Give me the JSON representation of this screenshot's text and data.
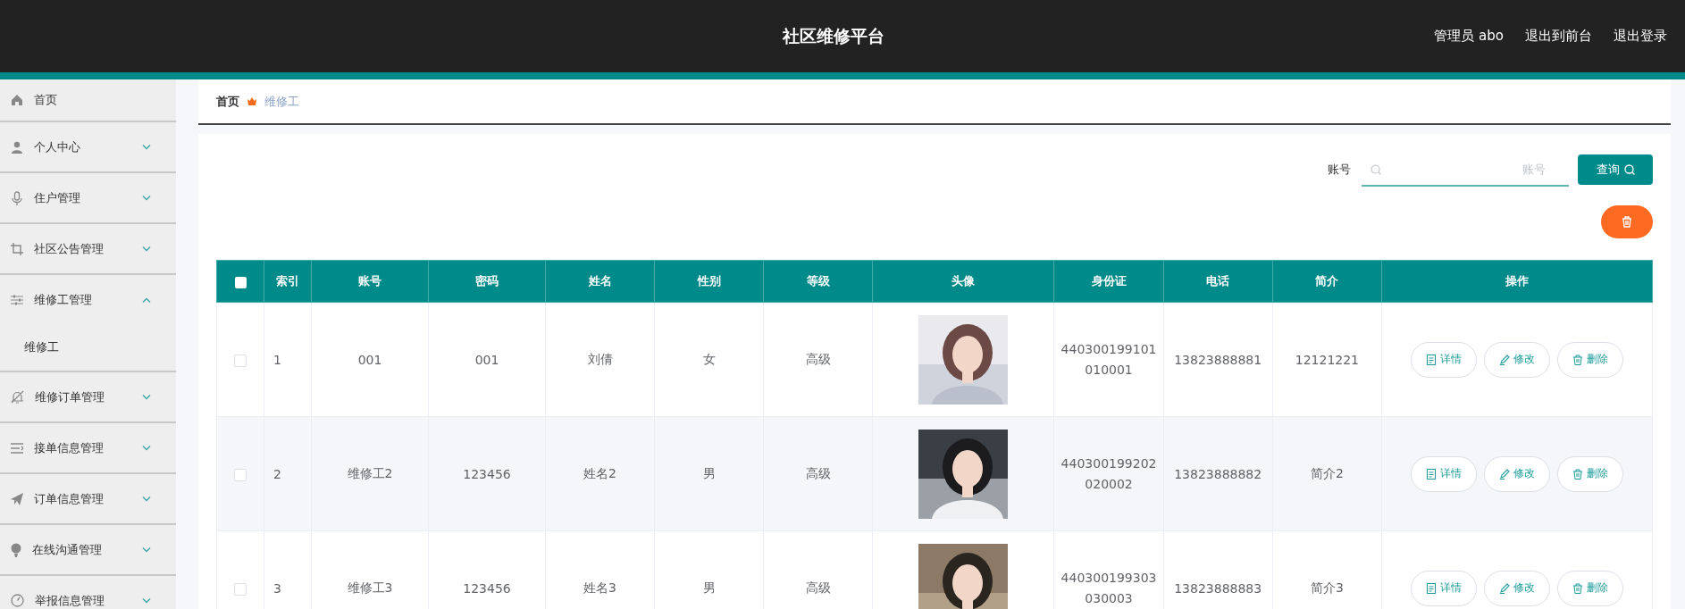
{
  "header": {
    "title": "社区维修平台",
    "user": "管理员 abo",
    "links": [
      "退出到前台",
      "退出登录"
    ]
  },
  "sidebar": {
    "items": [
      {
        "kind": "link",
        "label": "首页"
      },
      {
        "kind": "menu",
        "label": "个人中心",
        "expanded": false
      },
      {
        "kind": "menu",
        "label": "住户管理",
        "expanded": false
      },
      {
        "kind": "menu",
        "label": "社区公告管理",
        "expanded": false
      },
      {
        "kind": "menu",
        "label": "维修工管理",
        "expanded": true,
        "children": [
          {
            "label": "维修工"
          }
        ]
      },
      {
        "kind": "menu",
        "label": "维修订单管理",
        "expanded": false
      },
      {
        "kind": "menu",
        "label": "接单信息管理",
        "expanded": false
      },
      {
        "kind": "menu",
        "label": "订单信息管理",
        "expanded": false
      },
      {
        "kind": "menu",
        "label": "在线沟通管理",
        "expanded": false
      },
      {
        "kind": "menu",
        "label": "举报信息管理",
        "expanded": false
      }
    ]
  },
  "breadcrumb": [
    {
      "label": "首页",
      "current": false
    },
    {
      "label": "维修工",
      "current": true
    }
  ],
  "search": {
    "label": "账号",
    "placeholder": "账号",
    "button": "查询"
  },
  "table": {
    "select_all": {
      "checked": false
    },
    "columns": [
      "索引",
      "账号",
      "密码",
      "姓名",
      "性别",
      "等级",
      "头像",
      "身份证",
      "电话",
      "简介",
      "操作"
    ],
    "rows": [
      {
        "checked": false,
        "cells": [
          "1",
          "001",
          "001",
          "刘倩",
          "女",
          "高级"
        ],
        "cells_after": [
          "440300199101010001",
          "13823888881",
          "12121221"
        ],
        "actions": [
          {
            "kind": "detail",
            "label": "详情"
          },
          {
            "kind": "edit",
            "label": "修改"
          },
          {
            "kind": "delete",
            "label": "删除"
          }
        ]
      },
      {
        "checked": false,
        "cells": [
          "2",
          "维修工2",
          "123456",
          "姓名2",
          "男",
          "高级"
        ],
        "cells_after": [
          "440300199202020002",
          "13823888882",
          "简介2"
        ],
        "actions": [
          {
            "kind": "detail",
            "label": "详情"
          },
          {
            "kind": "edit",
            "label": "修改"
          },
          {
            "kind": "delete",
            "label": "删除"
          }
        ]
      },
      {
        "checked": false,
        "cells": [
          "3",
          "维修工3",
          "123456",
          "姓名3",
          "男",
          "高级"
        ],
        "cells_after": [
          "440300199303030003",
          "13823888883",
          "简介3"
        ],
        "actions": [
          {
            "kind": "detail",
            "label": "详情"
          },
          {
            "kind": "edit",
            "label": "修改"
          },
          {
            "kind": "delete",
            "label": "删除"
          }
        ]
      }
    ]
  }
}
